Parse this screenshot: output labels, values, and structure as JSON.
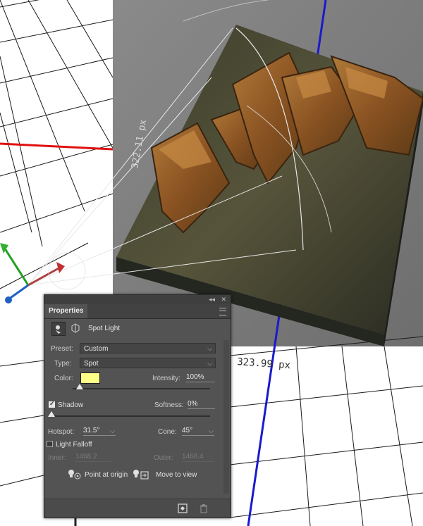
{
  "viewport": {
    "measurement_vertical": "322.11 px",
    "measurement_horizontal": "323.99 px",
    "colors": {
      "x_axis": "#e01010",
      "y_axis": "#1a1acc",
      "canvas_bg": "#7b7b7b",
      "grid": "#1a1a1a"
    },
    "scene_text": "RUST"
  },
  "panel": {
    "collapse_glyph": "◂◂",
    "close_glyph": "✕",
    "tab_label": "Properties",
    "title": "Spot Light",
    "preset": {
      "label": "Preset:",
      "value": "Custom"
    },
    "type": {
      "label": "Type:",
      "value": "Spot"
    },
    "color": {
      "label": "Color:",
      "swatch": "#ffff88"
    },
    "intensity": {
      "label": "Intensity:",
      "value": "100%",
      "level": 0.05
    },
    "shadow": {
      "label": "Shadow",
      "checked": true
    },
    "softness": {
      "label": "Softness:",
      "value": "0%",
      "level": 0.0
    },
    "hotspot": {
      "label": "Hotspot:",
      "value": "31.5°"
    },
    "cone": {
      "label": "Cone:",
      "value": "45°"
    },
    "light_falloff": {
      "label": "Light Falloff",
      "checked": false
    },
    "inner": {
      "label": "Inner:",
      "value": "1468.2"
    },
    "outer": {
      "label": "Outer:",
      "value": "1468.4"
    },
    "point_at_origin_label": "Point at origin",
    "move_to_view_label": "Move to view"
  }
}
